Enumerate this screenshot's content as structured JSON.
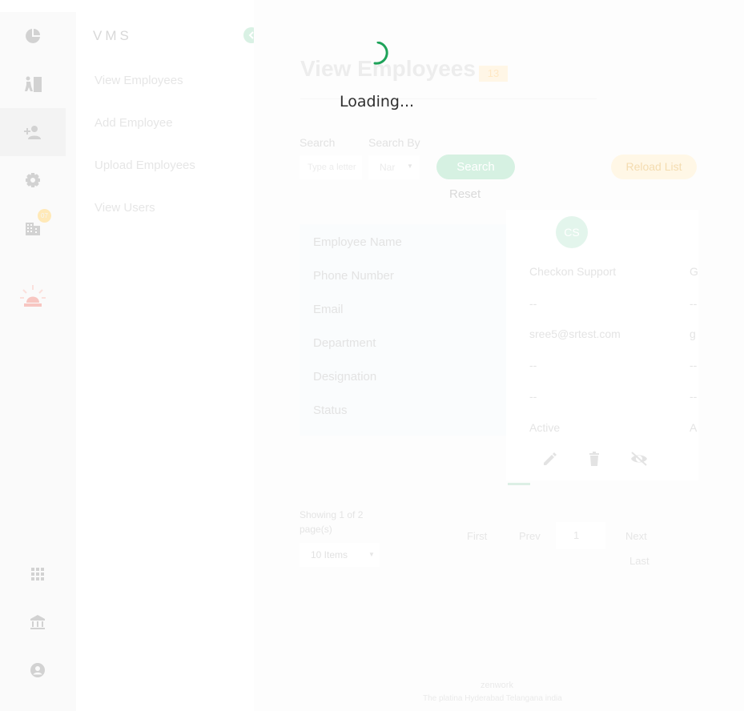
{
  "app": {
    "brand": "VMS"
  },
  "loading": {
    "text": "Loading..."
  },
  "sidebar_menu": {
    "items": [
      {
        "label": "View Employees"
      },
      {
        "label": "Add Employee"
      },
      {
        "label": "Upload Employees"
      },
      {
        "label": "View Users"
      }
    ]
  },
  "icon_rail": {
    "items": [
      "dashboard-icon",
      "visitor-door-icon",
      "add-person-icon",
      "settings-icon",
      "building-icon",
      "emergency-siren-icon",
      "apps-grid-icon",
      "institution-icon",
      "account-icon"
    ],
    "active": "add-person-icon",
    "badge": "07"
  },
  "page": {
    "title": "View Employees",
    "count": "13"
  },
  "filters": {
    "search_label": "Search",
    "search_placeholder": "Type a letter",
    "search_by_label": "Search By",
    "search_by_value": "Nar",
    "search_button": "Search",
    "reset_label": "Reset",
    "reload_button": "Reload List"
  },
  "table": {
    "row_labels": [
      "Employee Name",
      "Phone Number",
      "Email",
      "Department",
      "Designation",
      "Status"
    ],
    "employees": [
      {
        "initials": "CS",
        "name": "Checkon Support",
        "phone": "--",
        "email": "sree5@srtest.com",
        "department": "--",
        "designation": "--",
        "status": "Active"
      },
      {
        "initials": "",
        "name": "G",
        "phone": "--",
        "email": "g",
        "department": "--",
        "designation": "--",
        "status": "A"
      }
    ]
  },
  "pagination": {
    "showing": "Showing 1 of 2 page(s)",
    "page_size": "10 Items",
    "first": "First",
    "prev": "Prev",
    "current": "1",
    "next": "Next",
    "last": "Last"
  },
  "footer": {
    "company": "zenwork",
    "address": "The platina Hyderabad Telangana india"
  },
  "colors": {
    "accent_green": "#1fa35a",
    "spinner": "#1fa35a",
    "badge_amber": "#ffe8c4"
  }
}
